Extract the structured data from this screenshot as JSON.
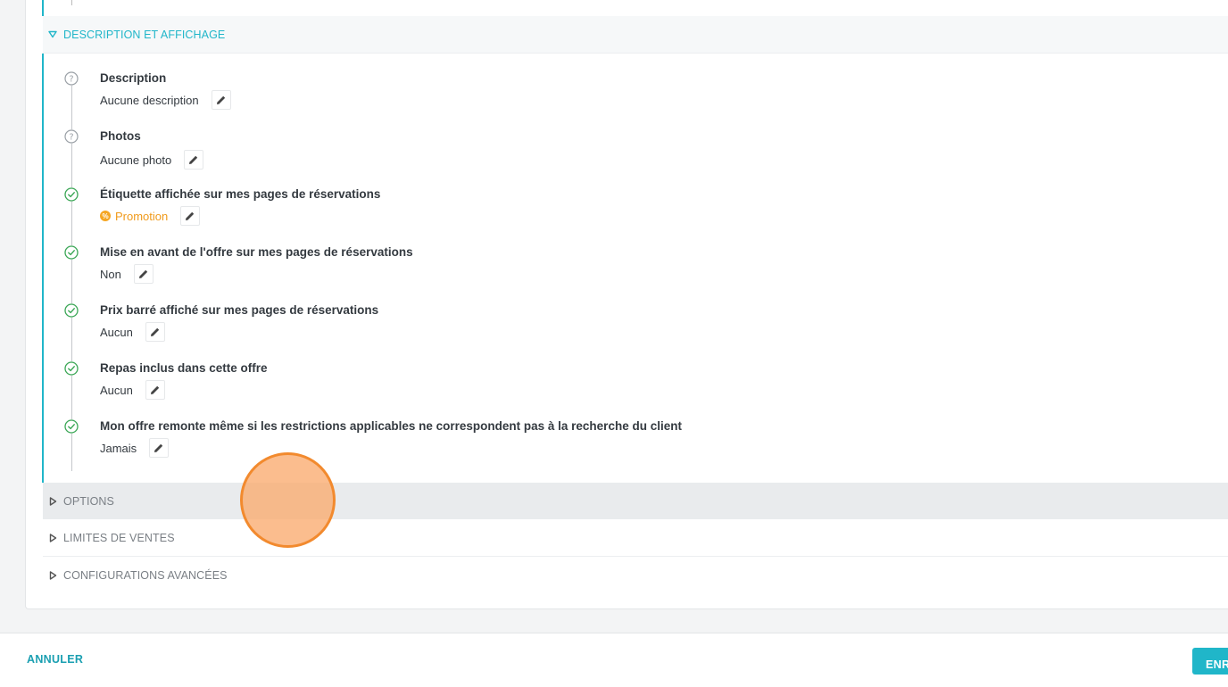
{
  "sections": {
    "description": {
      "label": "DESCRIPTION ET AFFICHAGE",
      "expanded": true
    },
    "options": {
      "label": "OPTIONS"
    },
    "limits": {
      "label": "LIMITES DE VENTES"
    },
    "advanced": {
      "label": "CONFIGURATIONS AVANCÉES"
    }
  },
  "items": [
    {
      "title": "Description",
      "value": "Aucune description",
      "status": "question-icon"
    },
    {
      "title": "Photos",
      "value": "Aucune photo",
      "status": "question-icon"
    },
    {
      "title": "Étiquette affichée sur mes pages de réservations",
      "value": "Promotion",
      "badge": "%",
      "status": "check-circle-icon"
    },
    {
      "title": "Mise en avant de l'offre sur mes pages de réservations",
      "value": "Non",
      "status": "check-circle-icon"
    },
    {
      "title": "Prix barré affiché sur mes pages de réservations",
      "value": "Aucun",
      "status": "check-circle-icon"
    },
    {
      "title": "Repas inclus dans cette offre",
      "value": "Aucun",
      "status": "check-circle-icon"
    },
    {
      "title": "Mon offre remonte même si les restrictions applicables ne correspondent pas à la recherche du client",
      "value": "Jamais",
      "status": "check-circle-icon"
    }
  ],
  "footer": {
    "cancel_label": "ANNULER",
    "save_label": "ENR"
  },
  "colors": {
    "accent": "#20b6c9",
    "success": "#3aa655",
    "muted": "#9aa0a6",
    "promo": "#f09a1a",
    "click_indicator": "#f28a2e"
  }
}
